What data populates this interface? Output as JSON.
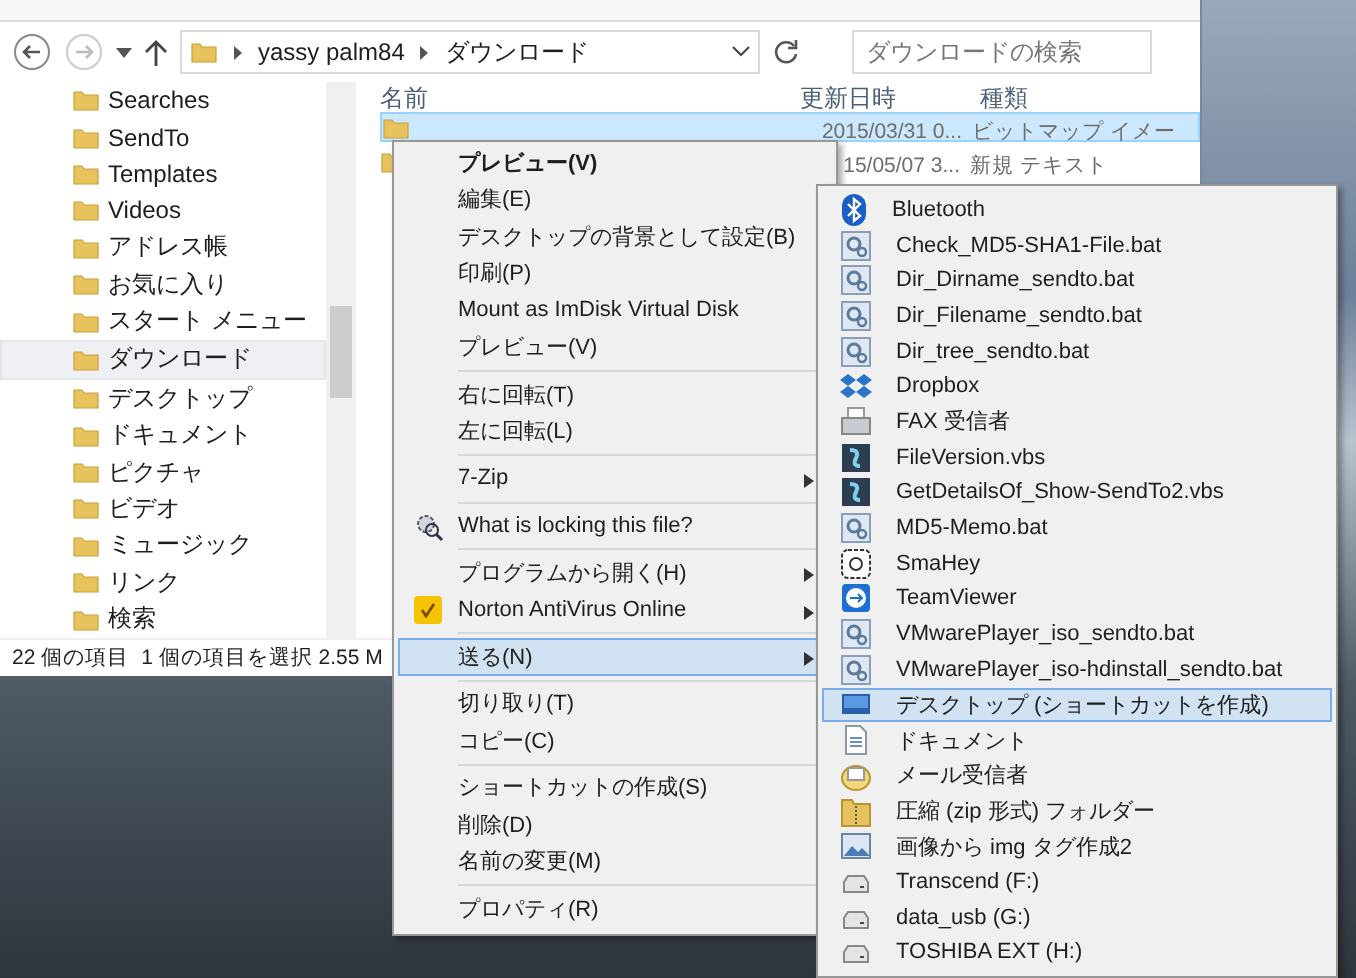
{
  "explorer": {
    "address": {
      "crumbs": [
        "yassy palm84",
        "ダウンロード"
      ]
    },
    "search": {
      "placeholder": "ダウンロードの検索"
    },
    "sidebar": {
      "items": [
        {
          "label": "Searches",
          "selected": false
        },
        {
          "label": "SendTo",
          "selected": false
        },
        {
          "label": "Templates",
          "selected": false
        },
        {
          "label": "Videos",
          "selected": false
        },
        {
          "label": "アドレス帳",
          "selected": false
        },
        {
          "label": "お気に入り",
          "selected": false
        },
        {
          "label": "スタート メニュー",
          "selected": false
        },
        {
          "label": "ダウンロード",
          "selected": true
        },
        {
          "label": "デスクトップ",
          "selected": false
        },
        {
          "label": "ドキュメント",
          "selected": false
        },
        {
          "label": "ピクチャ",
          "selected": false
        },
        {
          "label": "ビデオ",
          "selected": false
        },
        {
          "label": "ミュージック",
          "selected": false
        },
        {
          "label": "リンク",
          "selected": false
        },
        {
          "label": "検索",
          "selected": false
        }
      ]
    },
    "table": {
      "columns": [
        "名前",
        "更新日時",
        "種類"
      ],
      "rows": [
        {
          "date": "2015/03/31 0...",
          "type": "ビットマップ イメー",
          "selected": true
        },
        {
          "date": "15/05/07 3...",
          "type": "新規 テキスト",
          "selected": false
        }
      ]
    },
    "status_bar": {
      "count": "22 個の項目",
      "selection": "1 個の項目を選択 2.55 M"
    }
  },
  "context_menu": {
    "items": [
      {
        "kind": "item",
        "label": "プレビュー(V)",
        "default": true,
        "submenu": false,
        "selected": false
      },
      {
        "kind": "item",
        "label": "編集(E)",
        "default": false,
        "submenu": false,
        "selected": false
      },
      {
        "kind": "item",
        "label": "デスクトップの背景として設定(B)",
        "default": false,
        "submenu": false,
        "selected": false
      },
      {
        "kind": "item",
        "label": "印刷(P)",
        "default": false,
        "submenu": false,
        "selected": false
      },
      {
        "kind": "item",
        "label": "Mount as ImDisk Virtual Disk",
        "default": false,
        "submenu": false,
        "selected": false
      },
      {
        "kind": "item",
        "label": "プレビュー(V)",
        "default": false,
        "submenu": false,
        "selected": false
      },
      {
        "kind": "separator"
      },
      {
        "kind": "item",
        "label": "右に回転(T)",
        "default": false,
        "submenu": false,
        "selected": false
      },
      {
        "kind": "item",
        "label": "左に回転(L)",
        "default": false,
        "submenu": false,
        "selected": false
      },
      {
        "kind": "separator"
      },
      {
        "kind": "item",
        "label": "7-Zip",
        "default": false,
        "submenu": true,
        "selected": false
      },
      {
        "kind": "separator"
      },
      {
        "kind": "tool",
        "label": "What is locking this file?",
        "default": false,
        "submenu": false,
        "selected": false
      },
      {
        "kind": "separator"
      },
      {
        "kind": "item",
        "label": "プログラムから開く(H)",
        "default": false,
        "submenu": true,
        "selected": false
      },
      {
        "kind": "antivirus",
        "label": "Norton AntiVirus Online",
        "default": false,
        "submenu": true,
        "selected": false
      },
      {
        "kind": "separator"
      },
      {
        "kind": "item",
        "label": "送る(N)",
        "default": false,
        "submenu": true,
        "selected": true
      },
      {
        "kind": "separator"
      },
      {
        "kind": "item",
        "label": "切り取り(T)",
        "default": false,
        "submenu": false,
        "selected": false
      },
      {
        "kind": "item",
        "label": "コピー(C)",
        "default": false,
        "submenu": false,
        "selected": false
      },
      {
        "kind": "separator"
      },
      {
        "kind": "item",
        "label": "ショートカットの作成(S)",
        "default": false,
        "submenu": false,
        "selected": false
      },
      {
        "kind": "item",
        "label": "削除(D)",
        "default": false,
        "submenu": false,
        "selected": false
      },
      {
        "kind": "item",
        "label": "名前の変更(M)",
        "default": false,
        "submenu": false,
        "selected": false
      },
      {
        "kind": "separator"
      },
      {
        "kind": "item",
        "label": "プロパティ(R)",
        "default": false,
        "submenu": false,
        "selected": false
      }
    ]
  },
  "send_to_menu": {
    "items": [
      {
        "kind": "bluetooth",
        "label": "Bluetooth",
        "selected": false
      },
      {
        "kind": "script",
        "label": "Check_MD5-SHA1-File.bat",
        "selected": false
      },
      {
        "kind": "script",
        "label": "Dir_Dirname_sendto.bat",
        "selected": false
      },
      {
        "kind": "script",
        "label": "Dir_Filename_sendto.bat",
        "selected": false
      },
      {
        "kind": "script",
        "label": "Dir_tree_sendto.bat",
        "selected": false
      },
      {
        "kind": "dropbox",
        "label": "Dropbox",
        "selected": false
      },
      {
        "kind": "fax",
        "label": "FAX 受信者",
        "selected": false
      },
      {
        "kind": "vbs",
        "label": "FileVersion.vbs",
        "selected": false
      },
      {
        "kind": "vbs",
        "label": "GetDetailsOf_Show-SendTo2.vbs",
        "selected": false
      },
      {
        "kind": "script",
        "label": "MD5-Memo.bat",
        "selected": false
      },
      {
        "kind": "app",
        "label": "SmaHey",
        "selected": false
      },
      {
        "kind": "teamviewer",
        "label": "TeamViewer",
        "selected": false
      },
      {
        "kind": "script",
        "label": "VMwarePlayer_iso_sendto.bat",
        "selected": false
      },
      {
        "kind": "script",
        "label": "VMwarePlayer_iso-hdinstall_sendto.bat",
        "selected": false
      },
      {
        "kind": "desktop",
        "label": "デスクトップ (ショートカットを作成)",
        "selected": true
      },
      {
        "kind": "document",
        "label": "ドキュメント",
        "selected": false
      },
      {
        "kind": "mail",
        "label": "メール受信者",
        "selected": false
      },
      {
        "kind": "zip",
        "label": "圧縮 (zip 形式) フォルダー",
        "selected": false
      },
      {
        "kind": "image",
        "label": "画像から img タグ作成2",
        "selected": false
      },
      {
        "kind": "drive",
        "label": "Transcend (F:)",
        "selected": false
      },
      {
        "kind": "drive",
        "label": "data_usb (G:)",
        "selected": false
      },
      {
        "kind": "drive",
        "label": "TOSHIBA EXT (H:)",
        "selected": false
      }
    ]
  }
}
